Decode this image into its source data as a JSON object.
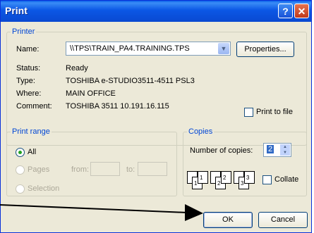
{
  "window": {
    "title": "Print",
    "help": "?",
    "close": "✕"
  },
  "printer": {
    "group_label": "Printer",
    "name_label": "Name:",
    "name_value": "\\\\TPS\\TRAIN_PA4.TRAINING.TPS",
    "properties_button": "Properties...",
    "status_label": "Status:",
    "status_value": "Ready",
    "type_label": "Type:",
    "type_value": "TOSHIBA e-STUDIO3511-4511 PSL3",
    "where_label": "Where:",
    "where_value": "MAIN OFFICE",
    "comment_label": "Comment:",
    "comment_value": "TOSHIBA 3511   10.191.16.115",
    "print_to_file": "Print to file"
  },
  "print_range": {
    "group_label": "Print range",
    "all": "All",
    "pages": "Pages",
    "from": "from:",
    "to": "to:",
    "selection": "Selection"
  },
  "copies": {
    "group_label": "Copies",
    "number_label": "Number of copies:",
    "number_value": "2",
    "collate": "Collate",
    "page_labels": [
      "1",
      "1",
      "2",
      "2",
      "3",
      "3"
    ]
  },
  "buttons": {
    "ok": "OK",
    "cancel": "Cancel"
  }
}
